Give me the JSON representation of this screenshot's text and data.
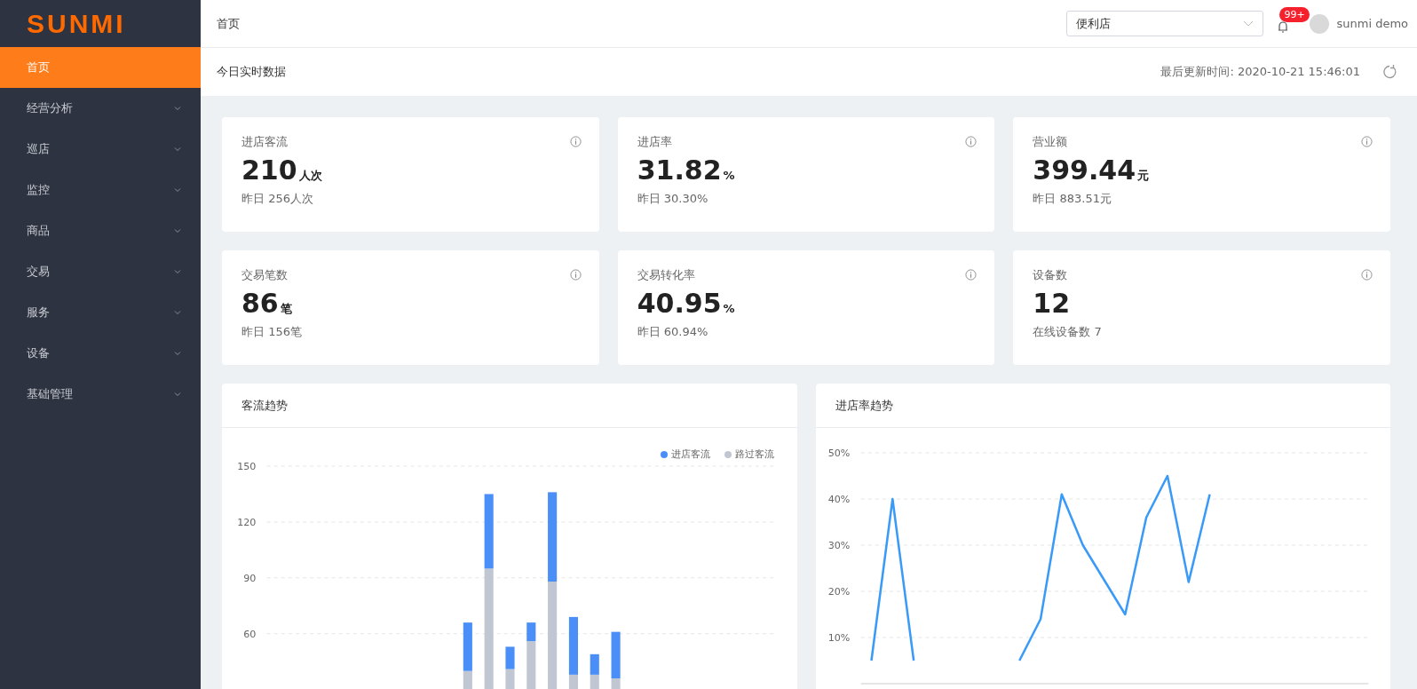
{
  "sidebar": {
    "logo": "SUNMI",
    "items": [
      {
        "label": "首页",
        "selected": true,
        "expandable": false
      },
      {
        "label": "经营分析",
        "selected": false,
        "expandable": true
      },
      {
        "label": "巡店",
        "selected": false,
        "expandable": true
      },
      {
        "label": "监控",
        "selected": false,
        "expandable": true
      },
      {
        "label": "商品",
        "selected": false,
        "expandable": true
      },
      {
        "label": "交易",
        "selected": false,
        "expandable": true
      },
      {
        "label": "服务",
        "selected": false,
        "expandable": true
      },
      {
        "label": "设备",
        "selected": false,
        "expandable": true
      },
      {
        "label": "基础管理",
        "selected": false,
        "expandable": true
      }
    ]
  },
  "header": {
    "breadcrumb": "首页",
    "store_select": {
      "value": "便利店"
    },
    "notifications": {
      "badge": "99+"
    },
    "user": {
      "name": "sunmi demo"
    }
  },
  "subheader": {
    "title": "今日实时数据",
    "updated": "最后更新时间: 2020-10-21 15:46:01"
  },
  "stats": [
    {
      "title": "进店客流",
      "value": "210",
      "unit": "人次",
      "compare": "昨日 256人次"
    },
    {
      "title": "进店率",
      "value": "31.82",
      "unit": "%",
      "compare": "昨日 30.30%"
    },
    {
      "title": "营业额",
      "value": "399.44",
      "unit": "元",
      "compare": "昨日 883.51元"
    },
    {
      "title": "交易笔数",
      "value": "86",
      "unit": "笔",
      "compare": "昨日 156笔"
    },
    {
      "title": "交易转化率",
      "value": "40.95",
      "unit": "%",
      "compare": "昨日 60.94%"
    },
    {
      "title": "设备数",
      "value": "12",
      "compare": "在线设备数 7"
    }
  ],
  "charts": [
    {
      "title": "客流趋势",
      "chart_data": {
        "type": "bar",
        "stacked": true,
        "grid": true,
        "legend": "top-right",
        "yticks": [
          60,
          90,
          120,
          150
        ],
        "ylim": [
          0,
          150
        ],
        "series": [
          {
            "name": "路过客流",
            "color": "#c1c7d2",
            "values": [
              null,
              null,
              null,
              null,
              null,
              null,
              null,
              null,
              null,
              40,
              95,
              41,
              56,
              88,
              38,
              38,
              36,
              null,
              null,
              null,
              null,
              null,
              null,
              null
            ]
          },
          {
            "name": "进店客流",
            "color": "#4a8ff7",
            "values": [
              null,
              null,
              null,
              null,
              null,
              null,
              null,
              null,
              null,
              26,
              40,
              12,
              10,
              48,
              31,
              11,
              25,
              null,
              null,
              null,
              null,
              null,
              null,
              null
            ]
          }
        ]
      }
    },
    {
      "title": "进店率趋势",
      "chart_data": {
        "type": "line",
        "grid": true,
        "ylim": [
          0,
          50
        ],
        "yticks": [
          {
            "value": 10,
            "label": "10%"
          },
          {
            "value": 20,
            "label": "20%"
          },
          {
            "value": 30,
            "label": "30%"
          },
          {
            "value": 40,
            "label": "40%"
          },
          {
            "value": 50,
            "label": "50%"
          }
        ],
        "series": [
          {
            "color": "#3a9af7",
            "values": [
              5,
              40,
              5,
              null,
              null,
              null,
              null,
              5,
              14,
              41,
              30,
              22.5,
              15,
              36,
              45,
              22,
              41,
              null,
              null,
              null,
              null,
              null,
              null,
              null
            ]
          }
        ]
      }
    }
  ]
}
